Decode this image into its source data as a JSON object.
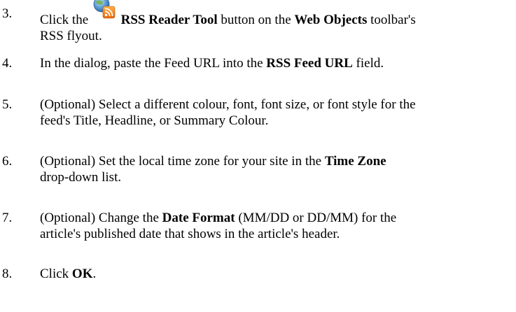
{
  "steps": [
    {
      "number": "3.",
      "lines": [
        [
          {
            "t": "Click the "
          },
          {
            "icon": "rss-reader-icon"
          },
          {
            "t": " "
          },
          {
            "t": "RSS Reader Tool",
            "b": true
          },
          {
            "t": " button on the "
          },
          {
            "t": "Web Objects",
            "b": true
          },
          {
            "t": " toolbar's"
          }
        ],
        [
          {
            "t": "RSS flyout."
          }
        ]
      ]
    },
    {
      "number": "4.",
      "lines": [
        [
          {
            "t": "In the dialog, paste the Feed URL into the "
          },
          {
            "t": "RSS Feed URL",
            "b": true
          },
          {
            "t": " field."
          }
        ]
      ]
    },
    {
      "number": "5.",
      "lines": [
        [
          {
            "t": "(Optional) Select a different colour, font, font size, or font style for the"
          }
        ],
        [
          {
            "t": "feed's Title, Headline, or Summary Colour."
          }
        ]
      ]
    },
    {
      "number": "6.",
      "lines": [
        [
          {
            "t": "(Optional) Set the local time zone for your site in the "
          },
          {
            "t": "Time Zone",
            "b": true
          }
        ],
        [
          {
            "t": "drop-down list."
          }
        ]
      ]
    },
    {
      "number": "7.",
      "lines": [
        [
          {
            "t": "(Optional) Change the "
          },
          {
            "t": "Date Format",
            "b": true
          },
          {
            "t": " (MM/DD or DD/MM) for the"
          }
        ],
        [
          {
            "t": "article's published date that shows in the article's header."
          }
        ]
      ]
    },
    {
      "number": "8.",
      "lines": [
        [
          {
            "t": "Click "
          },
          {
            "t": "OK",
            "b": true
          },
          {
            "t": "."
          }
        ]
      ]
    }
  ]
}
